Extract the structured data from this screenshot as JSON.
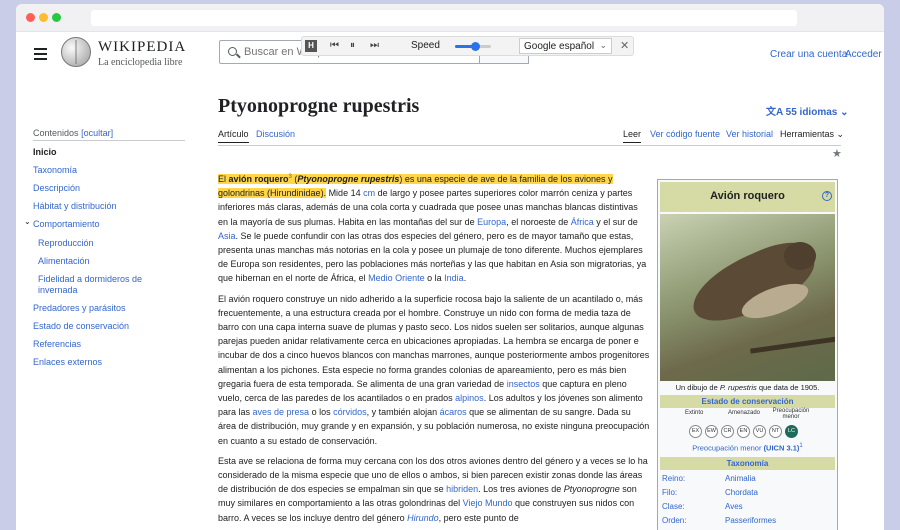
{
  "header": {
    "wordmark": "WIKIPEDIA",
    "tagline": "La enciclopedia libre",
    "search_placeholder": "Buscar en Wikipedia",
    "search_button": "Buscar",
    "create_account": "Crear una cuenta",
    "login": "Acceder"
  },
  "tts": {
    "h_label": "H",
    "speed_label": "Speed",
    "speed_level_pct": 55,
    "voice": "Google español",
    "close": "✕"
  },
  "article": {
    "title": "Ptyonoprogne rupestris",
    "languages": "55 idiomas",
    "tabs": [
      "Artículo",
      "Discusión"
    ],
    "actions": [
      "Leer",
      "Ver código fuente",
      "Ver historial",
      "Herramientas"
    ]
  },
  "toc": {
    "heading": "Contenidos",
    "hide": "[ocultar]",
    "items": [
      "Inicio",
      "Taxonomía",
      "Descripción",
      "Hábitat y distribución",
      "Comportamiento",
      "Reproducción",
      "Alimentación",
      "Fidelidad a dormideros de invernada",
      "Predadores y parásitos",
      "Estado de conservación",
      "Referencias",
      "Enlaces externos"
    ]
  },
  "paragraphs": {
    "p1": {
      "hl_a": "El ",
      "hl_b": "avión roquero",
      "sup": "3",
      "hl_c": " (",
      "hl_d": "Ptyonoprogne rupestris",
      "hl_e": ") es una especie de ave de la familia de los aviones y golondrinas (Hirundinidae).",
      "t1": " Mide 14 ",
      "l_cm": "cm",
      "t2": " de largo y posee partes superiores color marrón ceniza y partes inferiores más claras, además de una cola corta y cuadrada que posee unas manchas blancas distintivas en la mayoría de sus plumas. Habita en las montañas del sur de ",
      "l_europa": "Europa",
      "t3": ", el noroeste de ",
      "l_africa": "África",
      "t4": " y el sur de ",
      "l_asia": "Asia",
      "t5": ". Se le puede confundir con las otras dos especies del género, pero es de mayor tamaño que estas, presenta unas manchas más notorias en la cola y posee un plumaje de tono diferente. Muchos ejemplares de Europa son residentes, pero las poblaciones más norteñas y las que habitan en Asia son migratorias, ya que hibernan en el norte de África, el ",
      "l_mo": "Medio Oriente",
      "t6": " o la ",
      "l_india": "India",
      "t7": "."
    },
    "p2": {
      "t1": "El avión roquero construye un nido adherido a la superficie rocosa bajo la saliente de un acantilado o, más frecuentemente, a una estructura creada por el hombre. Construye un nido con forma de media taza de barro con una capa interna suave de plumas y pasto seco. Los nidos suelen ser solitarios, aunque algunas parejas pueden anidar relativamente cerca en ubicaciones apropiadas. La hembra se encarga de poner e incubar de dos a cinco huevos blancos con manchas marrones, aunque posteriormente ambos progenitores alimentan a los pichones. Esta especie no forma grandes colonias de apareamiento, pero es más bien gregaria fuera de esta temporada. Se alimenta de una gran variedad de ",
      "l_insectos": "insectos",
      "t2": " que captura en pleno vuelo, cerca de las paredes de los acantilados o en prados ",
      "l_alpinos": "alpinos",
      "t3": ". Los adultos y los jóvenes son alimento para las ",
      "l_aves": "aves de presa",
      "t4": " o los ",
      "l_corvidos": "córvidos",
      "t5": ", y también alojan ",
      "l_acaros": "ácaros",
      "t6": " que se alimentan de su sangre. Dada su área de distribución, muy grande y en expansión, y su población numerosa, no existe ninguna preocupación en cuanto a su estado de conservación."
    },
    "p3": {
      "t1": "Esta ave se relaciona de forma muy cercana con los dos otros aviones dentro del género y a veces se lo ha considerado de la misma especie que uno de ellos o ambos, si bien parecen existir zonas donde las áreas de distribución de dos especies se empalman sin que se ",
      "l_hibriden": "hibriden",
      "t2": ". Los tres aviones de ",
      "i_ptyo": "Ptyonoprogne",
      "t3": " son muy similares en comportamiento a las otras golondrinas del ",
      "l_viejo": "Viejo Mundo",
      "t4": " que construyen sus nidos con barro. A veces se los incluye dentro del género ",
      "l_hirundo": "Hirundo",
      "t5": ", pero este punto de"
    }
  },
  "infobox": {
    "title": "Avión roquero",
    "help": "?",
    "caption_a": "Un dibujo de ",
    "caption_i": "P. rupestris",
    "caption_b": " que data de 1905.",
    "status_header": "Estado de conservación",
    "scale_labels": [
      "Extinto",
      "Amenazado",
      "Preocupación menor"
    ],
    "scale": [
      "EX",
      "EW",
      "CR",
      "EN",
      "VU",
      "NT",
      "LC"
    ],
    "selected": "LC",
    "status_text": "Preocupación menor",
    "status_code": "(UICN 3.1)",
    "status_sup": "1",
    "taxonomy_header": "Taxonomía",
    "taxonomy": [
      {
        "k": "Reino:",
        "v": "Animalia"
      },
      {
        "k": "Filo:",
        "v": "Chordata"
      },
      {
        "k": "Clase:",
        "v": "Aves"
      },
      {
        "k": "Orden:",
        "v": "Passeriformes"
      }
    ]
  }
}
